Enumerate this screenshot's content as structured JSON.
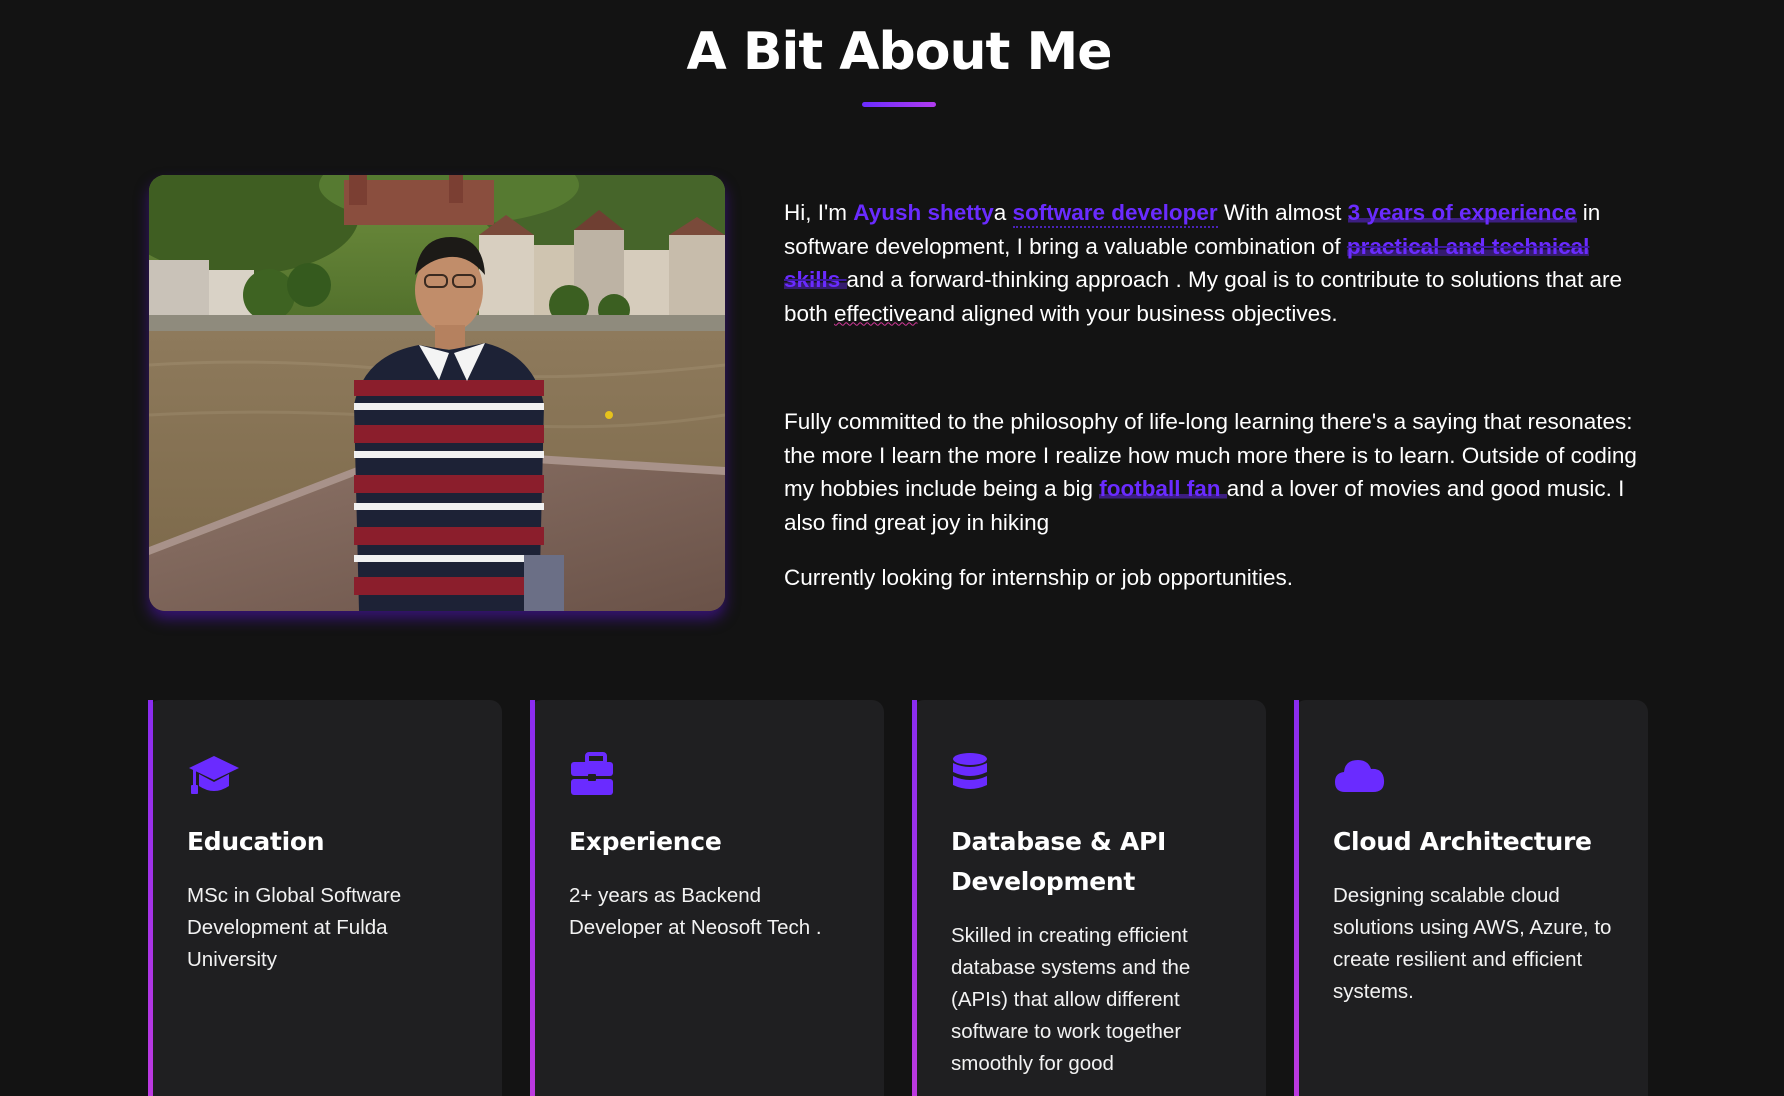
{
  "section": {
    "title": "A Bit About Me"
  },
  "photo": {
    "alt": "Portrait of Ayush Shetty on a bridge over a river with a hillside town and castle behind"
  },
  "bio": {
    "p1": {
      "t1": "Hi, I'm ",
      "name": "Ayush shetty",
      "t2": "a ",
      "role": "software developer",
      "t3": " With almost ",
      "experience": "3 years of experience",
      "t4": " in software development, I bring a valuable combination of ",
      "skills": "practical and technical skills ",
      "t5": "and a forward-thinking approach . My goal is to contribute to solutions that are both ",
      "effective": "effective",
      "t6": "and aligned with your business objectives."
    },
    "p2": {
      "t1": "Fully committed to the philosophy of life-long learning there's a saying that resonates: the more I learn the more I realize how much more there is to learn. Outside of coding my hobbies include being a big ",
      "hobby": "football fan ",
      "t2": "and a lover of movies and good music. I also find great joy in hiking"
    },
    "p3": "Currently looking for internship or job opportunities."
  },
  "cards": [
    {
      "icon": "graduation-cap-icon",
      "title": "Education",
      "text": "MSc in Global Software Development at Fulda University"
    },
    {
      "icon": "briefcase-icon",
      "title": "Experience",
      "text": "2+ years as Backend Developer at Neosoft Tech ."
    },
    {
      "icon": "database-icon",
      "title": "Database & API Development",
      "text": "Skilled in creating efficient database systems and the (APIs) that allow different software to work together smoothly for good"
    },
    {
      "icon": "cloud-icon",
      "title": "Cloud Architecture",
      "text": "Designing scalable cloud solutions using AWS, Azure, to create resilient and efficient systems."
    }
  ],
  "colors": {
    "background": "#131313",
    "card_background": "#1f1f21",
    "accent": "#6a2bff",
    "accent_gradient_end": "#c03adf"
  }
}
